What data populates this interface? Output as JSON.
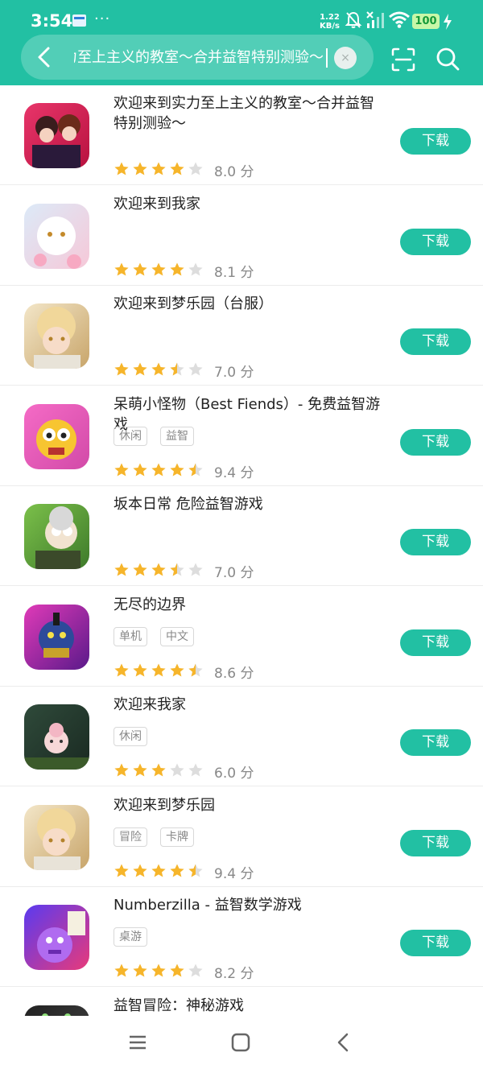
{
  "status": {
    "time": "3:54",
    "dots": "···",
    "net_speed_value": "1.22",
    "net_speed_unit": "KB/s",
    "battery": "100"
  },
  "search": {
    "query": "欢迎来到实力至上主义的教室～合并益智特别测验～",
    "clear_icon": "×"
  },
  "colors": {
    "accent": "#22c0a3",
    "star": "#f6b52b",
    "star_empty": "#dddddd"
  },
  "apps": [
    {
      "title": "欢迎来到实力至上主义的教室～合并益智特别测验～",
      "tags": [],
      "stars": 4,
      "half": false,
      "score": "8.0 分",
      "button": "下载",
      "icon": "anime-couple-icon"
    },
    {
      "title": "欢迎来到我家",
      "tags": [],
      "stars": 4,
      "half": false,
      "score": "8.1 分",
      "button": "下载",
      "icon": "white-cat-girl-icon"
    },
    {
      "title": "欢迎来到梦乐园（台服）",
      "tags": [],
      "stars": 3,
      "half": true,
      "score": "7.0 分",
      "button": "下载",
      "icon": "blond-boy-icon"
    },
    {
      "title": "呆萌小怪物（Best Fiends）- 免费益智游戏",
      "tags": [
        "休闲",
        "益智"
      ],
      "stars": 4,
      "half": true,
      "score": "9.4 分",
      "button": "下载",
      "icon": "yellow-bug-icon"
    },
    {
      "title": "坂本日常 危险益智游戏",
      "tags": [],
      "stars": 3,
      "half": true,
      "score": "7.0 分",
      "button": "下载",
      "icon": "old-man-glasses-icon"
    },
    {
      "title": "无尽的边界",
      "tags": [
        "单机",
        "中文"
      ],
      "stars": 4,
      "half": true,
      "score": "8.6 分",
      "button": "下载",
      "icon": "armored-beast-icon"
    },
    {
      "title": "欢迎来我家",
      "tags": [
        "休闲"
      ],
      "stars": 3,
      "half": false,
      "score": "6.0 分",
      "button": "下载",
      "icon": "forest-girl-icon"
    },
    {
      "title": "欢迎来到梦乐园",
      "tags": [
        "冒险",
        "卡牌"
      ],
      "stars": 4,
      "half": true,
      "score": "9.4 分",
      "button": "下载",
      "icon": "blond-boy-icon"
    },
    {
      "title": "Numberzilla - 益智数学游戏",
      "tags": [
        "桌游"
      ],
      "stars": 4,
      "half": false,
      "score": "8.2 分",
      "button": "下载",
      "icon": "purple-monster-icon"
    },
    {
      "title": "益智冒险：神秘游戏",
      "tags": [],
      "stars": 0,
      "half": false,
      "score": "",
      "button": "",
      "icon": "dark-game-icon"
    }
  ]
}
